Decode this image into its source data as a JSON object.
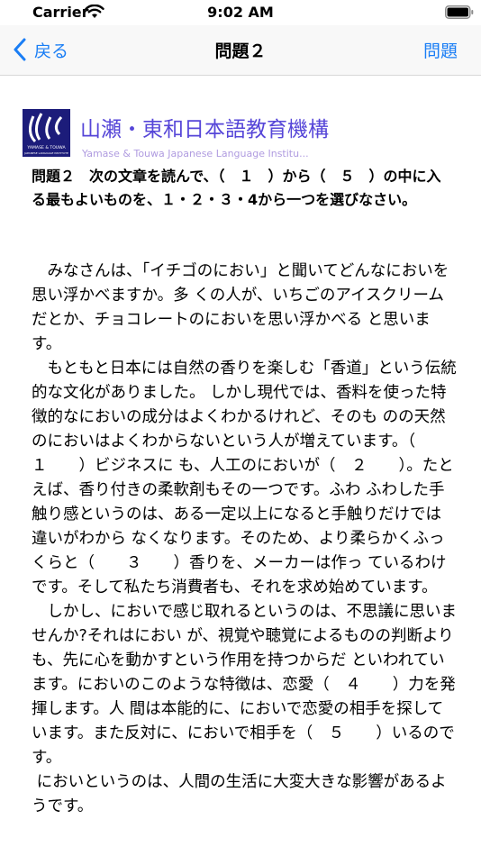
{
  "status_bar": {
    "carrier": "Carrier",
    "time": "9:02 AM"
  },
  "nav": {
    "back_label": "戻る",
    "title": "問題２",
    "right_label": "問題"
  },
  "brand": {
    "name": "山瀬・東和日本語教育機構",
    "subtitle": "Yamase & Touwa Japanese Language Institu...",
    "logo_text": "YAMASE & TOUWA",
    "logo_subtext": "JAPANESE LANGUAGE INSTITUTE"
  },
  "question": {
    "instructions": "問題２　次の文章を読んで、（　１　）から（　５　）の中に入る最もよいものを、１・２・３・4から一つを選びなさい。"
  },
  "passage": {
    "paragraphs": [
      "　みなさんは、「イチゴのにおい」と聞いてどんなにおいを思い浮かべますか。多 くの人が、いちごのアイスクリームだとか、チョコレートのにおいを思い浮かべる と思います。",
      "　もともと日本には自然の香りを楽しむ「香道」という伝統的な文化がありました。 しかし現代では、香料を使った特徴的なにおいの成分はよくわかるけれど、そのも のの天然のにおいはよくわからないという人が増えています。（　　１　　）ビジネスに も、人工のにおいが（　２　　）。たとえば、香り付きの柔軟剤もその一つです。ふわ ふわした手触り感というのは、ある一定以上になると手触りだけでは違いがわから なくなります。そのため、より柔らかくふっくらと（　　３　　）香りを、メーカーは作っ ているわけです。そして私たち消費者も、それを求め始めています。",
      "　しかし、においで感じ取れるというのは、不思議に思いませんか?それはにおい が、視覚や聴覚によるものの判断よりも、先に心を動かすという作用を持つからだ といわれています。においのこのような特徴は、恋愛（　４　　）力を発揮します。人 間は本能的に、においで恋愛の相手を探しています。また反対に、においで相手を（　５　　）いるのです。",
      " においというのは、人間の生活に大変大きな影響があるようです。"
    ]
  },
  "colors": {
    "accent": "#1a7ef5",
    "brand": "#5646d8",
    "brand_sub": "#b09ce0",
    "logo_bg": "#1c1c7a"
  },
  "icons": {
    "wifi": "wifi-icon",
    "battery": "battery-icon",
    "back": "chevron-left-icon",
    "logo": "institute-logo"
  }
}
